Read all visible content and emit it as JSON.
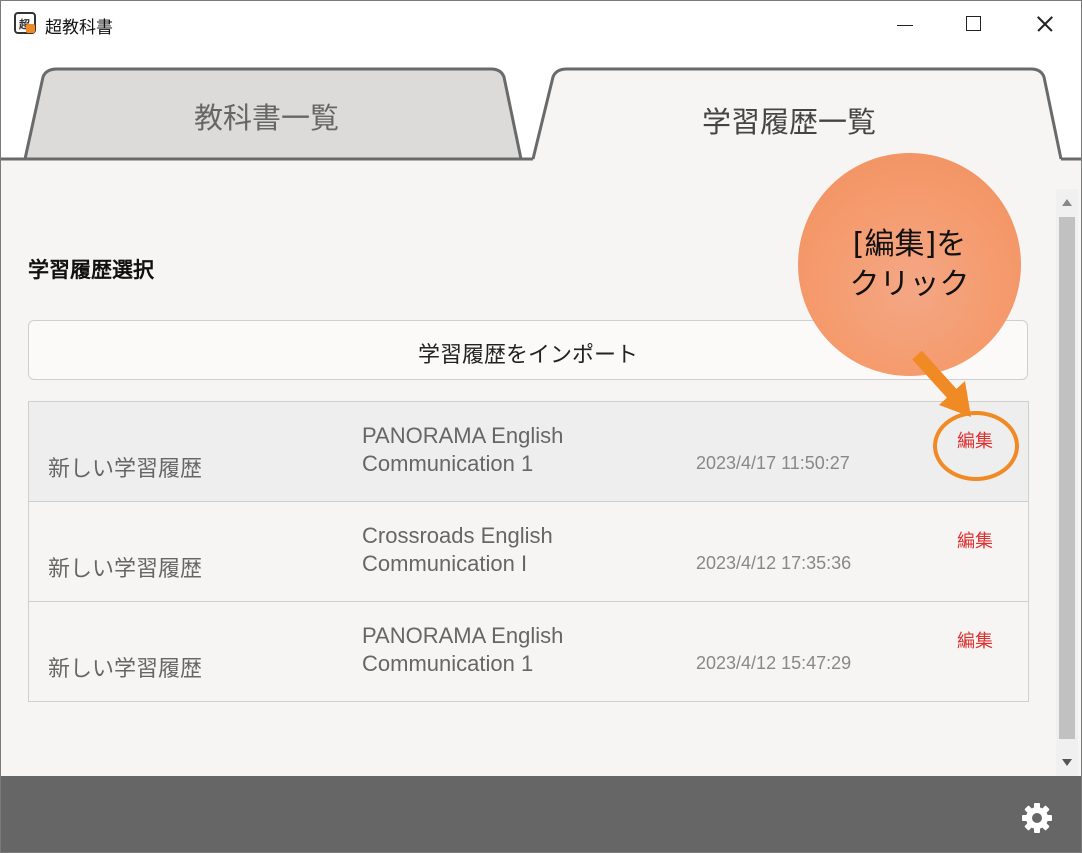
{
  "window": {
    "title": "超教科書",
    "icon": "app-logo-icon",
    "controls": [
      "minimize-icon",
      "maximize-icon",
      "close-icon"
    ]
  },
  "tabs": [
    {
      "label": "教科書一覧",
      "active": false
    },
    {
      "label": "学習履歴一覧",
      "active": true
    }
  ],
  "main": {
    "section_title": "学習履歴選択",
    "import_button": "学習履歴をインポート",
    "history": [
      {
        "name": "新しい学習履歴",
        "title_line1": "PANORAMA English",
        "title_line2": "Communication 1",
        "date": "2023/4/17 11:50:27",
        "edit": "編集",
        "selected": true
      },
      {
        "name": "新しい学習履歴",
        "title_line1": "Crossroads English",
        "title_line2": "Communication I",
        "date": "2023/4/12 17:35:36",
        "edit": "編集",
        "selected": false
      },
      {
        "name": "新しい学習履歴",
        "title_line1": "PANORAMA English",
        "title_line2": "Communication 1",
        "date": "2023/4/12 15:47:29",
        "edit": "編集",
        "selected": false
      }
    ]
  },
  "callout": {
    "line1": "[編集]を",
    "line2": "クリック"
  },
  "footer": {
    "settings_icon": "gear-icon"
  },
  "colors": {
    "accent": "#f08a24",
    "edit_text": "#e03030",
    "footer_bg": "#666666",
    "callout_bg": "#f59a6c"
  }
}
